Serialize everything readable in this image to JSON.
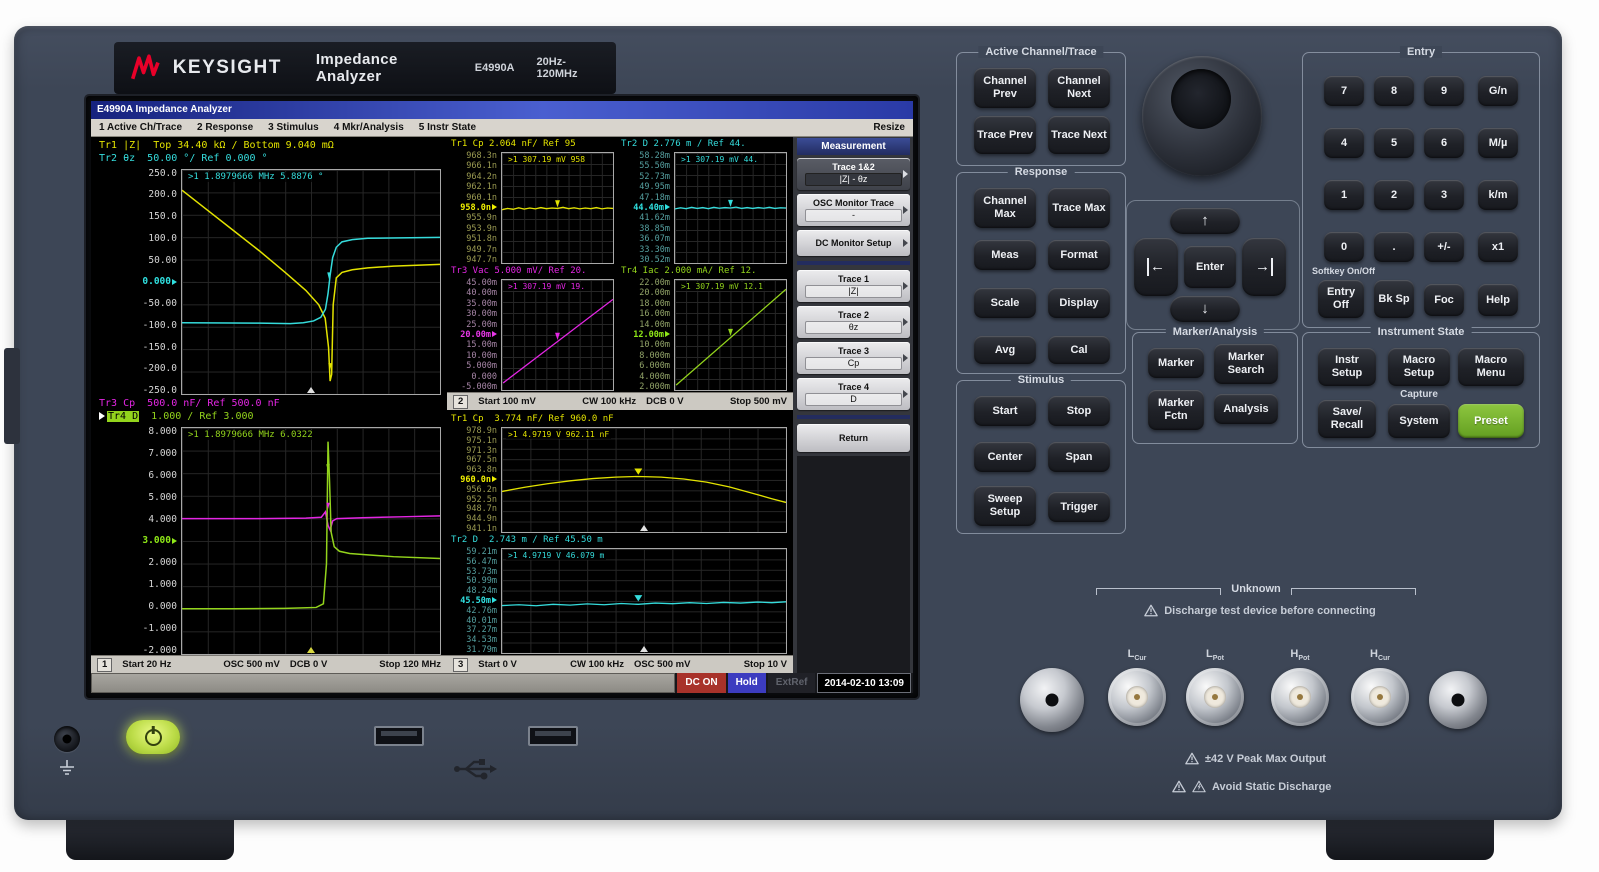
{
  "brand": {
    "company": "KEYSIGHT",
    "product": "Impedance Analyzer",
    "model": "E4990A",
    "freq_range": "20Hz-120MHz"
  },
  "lcd": {
    "title": "E4990A Impedance Analyzer",
    "menu": [
      "1 Active Ch/Trace",
      "2 Response",
      "3 Stimulus",
      "4 Mkr/Analysis",
      "5 Instr State"
    ],
    "resize": "Resize",
    "ch1": {
      "tr1_name": "Tr1 |Z|",
      "tr1_scale": "Top 34.40 kΩ / Bottom 9.040 mΩ",
      "tr2_name": "Tr2 θz",
      "tr2_scale": "50.00 °/ Ref 0.000 °",
      "marker_top": ">1 1.8979666 MHz   5.8876 °",
      "yticks_top": [
        "250.0",
        "200.0",
        "150.0",
        "100.0",
        "50.00",
        "0.000",
        "-50.00",
        "-100.0",
        "-150.0",
        "-200.0",
        "-250.0"
      ],
      "tr3_name": "Tr3 Cp",
      "tr3_scale": "500.0 nF/ Ref 500.0 nF",
      "tr4_name": "Tr4 D",
      "tr4_scale": "1.000 / Ref 3.000",
      "marker_bot": ">1 1.8979666 MHz   6.0322",
      "yticks_bot": [
        "8.000",
        "7.000",
        "6.000",
        "5.000",
        "4.000",
        "3.000",
        "2.000",
        "1.000",
        "0.000",
        "-1.000",
        "-2.000"
      ],
      "status": {
        "num": "1",
        "a": "Start 20 Hz",
        "b": "OSC 500 mV",
        "c": "DCB 0 V",
        "d": "Stop 120 MHz"
      }
    },
    "ch2": {
      "tr1_name": "Tr1 Cp",
      "tr1_scale": "2.064 nF/ Ref 95",
      "tr2_name": "Tr2 D",
      "tr2_scale": "2.776 m / Ref 44.",
      "m1": ">1 307.19 mV  958",
      "m2": ">1 307.19 mV  44.",
      "y1": [
        "968.3n",
        "966.1n",
        "964.2n",
        "962.1n",
        "960.1n",
        "958.0n",
        "955.9n",
        "953.9n",
        "951.8n",
        "949.7n",
        "947.7n"
      ],
      "y2": [
        "58.28m",
        "55.50m",
        "52.73m",
        "49.95m",
        "47.18m",
        "44.40m",
        "41.62m",
        "38.85m",
        "36.07m",
        "33.30m",
        "30.52m"
      ],
      "tr3_name": "Tr3 Vac",
      "tr3_scale": "5.000 mV/ Ref 20.",
      "tr4_name": "Tr4 Iac",
      "tr4_scale": "2.000 mA/ Ref 12.",
      "m3": ">1 307.19 mV  19.",
      "m4": ">1 307.19 mV  12.1",
      "y3": [
        "45.00m",
        "40.00m",
        "35.00m",
        "30.00m",
        "25.00m",
        "20.00m",
        "15.00m",
        "10.00m",
        "5.000m",
        "0.000",
        "-5.000m"
      ],
      "y4": [
        "22.00m",
        "20.00m",
        "18.00m",
        "16.00m",
        "14.00m",
        "12.00m",
        "10.00m",
        "8.000m",
        "6.000m",
        "4.000m",
        "2.000m"
      ],
      "status": {
        "num": "2",
        "a": "Start 100 mV",
        "b": "CW 100 kHz",
        "c": "DCB 0 V",
        "d": "Stop 500 mV"
      }
    },
    "ch3": {
      "tr1_name": "Tr1 Cp",
      "tr1_scale": "3.774 nF/ Ref 960.0 nF",
      "m1": ">1 4.9719 V  962.11 nF",
      "y1": [
        "978.9n",
        "975.1n",
        "971.3n",
        "967.5n",
        "963.8n",
        "960.0n",
        "956.2n",
        "952.5n",
        "948.7n",
        "944.9n",
        "941.1n"
      ],
      "tr2_name": "Tr2 D",
      "tr2_scale": "2.743 m / Ref 45.50 m",
      "m2": ">1 4.9719 V  46.079 m",
      "y2": [
        "59.21m",
        "56.47m",
        "53.73m",
        "50.99m",
        "48.24m",
        "45.50m",
        "42.76m",
        "40.01m",
        "37.27m",
        "34.53m",
        "31.79m"
      ],
      "status": {
        "num": "3",
        "a": "Start 0 V",
        "b": "CW 100 kHz",
        "c": "OSC 500 mV",
        "d": "Stop 10 V"
      }
    },
    "softkeys": {
      "header": "Measurement",
      "items": [
        {
          "label": "Trace 1&2",
          "value": "|Z| - θz"
        },
        {
          "label": "OSC Monitor Trace",
          "value": "-"
        },
        {
          "label": "DC Monitor Setup"
        },
        {
          "label": "Trace 1",
          "value": "|Z|"
        },
        {
          "label": "Trace 2",
          "value": "θz"
        },
        {
          "label": "Trace 3",
          "value": "Cp"
        },
        {
          "label": "Trace 4",
          "value": "D"
        },
        {
          "label": "Return"
        }
      ]
    },
    "statusbar": {
      "dc": "DC ON",
      "trigger": "Hold",
      "ref": "ExtRef",
      "datetime": "2014-02-10 13:09"
    }
  },
  "panel": {
    "active": {
      "label": "Active Channel/Trace",
      "b": [
        "Channel Prev",
        "Channel Next",
        "Trace Prev",
        "Trace Next"
      ]
    },
    "response": {
      "label": "Response",
      "b": [
        "Channel Max",
        "Trace Max",
        "Meas",
        "Format",
        "Scale",
        "Display",
        "Avg",
        "Cal"
      ]
    },
    "stimulus": {
      "label": "Stimulus",
      "b": [
        "Start",
        "Stop",
        "Center",
        "Span",
        "Sweep Setup",
        "Trigger"
      ]
    },
    "marker": {
      "label": "Marker/Analysis",
      "b": [
        "Marker",
        "Marker Search",
        "Marker Fctn",
        "Analysis"
      ]
    },
    "nav": {
      "up": "↑",
      "down": "↓",
      "left": "←",
      "right": "→",
      "enter": "Enter"
    },
    "entry": {
      "label": "Entry",
      "keys": [
        [
          "7",
          "8",
          "9",
          "G/n"
        ],
        [
          "4",
          "5",
          "6",
          "M/µ"
        ],
        [
          "1",
          "2",
          "3",
          "k/m"
        ],
        [
          "0",
          ".",
          "+/-",
          "x1"
        ]
      ],
      "softkey_onoff": "Softkey On/Off",
      "bottom": [
        "Entry Off",
        "Bk Sp",
        "Foc",
        "Help"
      ]
    },
    "instr": {
      "label": "Instrument State",
      "top": [
        "Instr Setup",
        "Macro Setup",
        "Macro Menu"
      ],
      "capture": "Capture",
      "bottom": [
        "Save/ Recall",
        "System",
        "Preset"
      ]
    },
    "unknown": {
      "label": "Unknown",
      "warning": "Discharge test device before connecting",
      "connectors": [
        {
          "main": "L",
          "sub": "Cur"
        },
        {
          "main": "L",
          "sub": "Pot"
        },
        {
          "main": "H",
          "sub": "Pot"
        },
        {
          "main": "H",
          "sub": "Cur"
        }
      ]
    },
    "warnings": [
      "±42 V Peak Max Output",
      "Avoid Static Discharge"
    ]
  },
  "colors": {
    "trace_yellow": "#e3e300",
    "trace_cyan": "#35dcdc",
    "trace_magenta": "#e426e4",
    "trace_green": "#93d41c",
    "dc_on_bg": "#a8322a",
    "hold_bg": "#3c3cc0",
    "preset_green": "#76b82a",
    "brand_red": "#e90029"
  }
}
